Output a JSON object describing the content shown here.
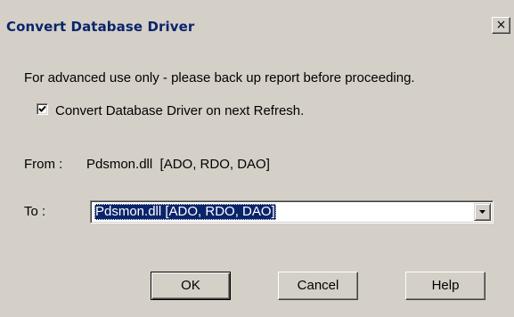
{
  "dialog": {
    "title": "Convert Database Driver",
    "close_glyph": "×",
    "warning": "For advanced use only - please back up report before proceeding.",
    "checkbox": {
      "label": "Convert Database Driver on next Refresh.",
      "checked": true
    },
    "from_label": "From :",
    "from_value": "Pdsmon.dll  [ADO, RDO, DAO]",
    "to_label": "To :",
    "to_selected": "Pdsmon.dll [ADO, RDO, DAO]",
    "buttons": {
      "ok": "OK",
      "cancel": "Cancel",
      "help": "Help"
    }
  }
}
